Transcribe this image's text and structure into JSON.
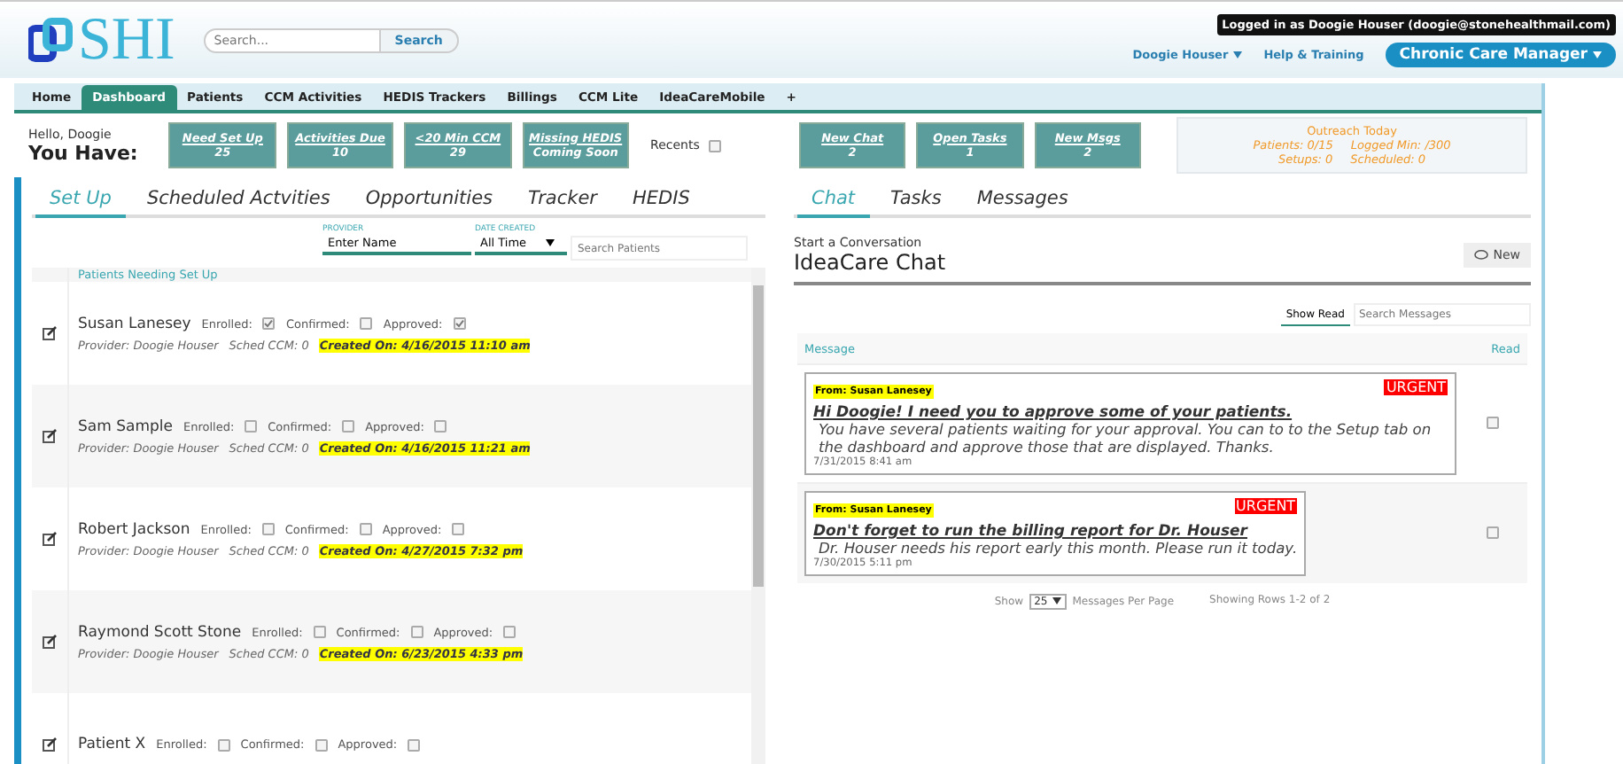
{
  "header": {
    "logo": "SHI",
    "search": {
      "placeholder": "Search...",
      "button": "Search"
    },
    "login_badge": "Logged in as Doogie Houser (doogie@stonehealthmail.com)",
    "user_menu": "Doogie Houser",
    "help_link": "Help & Training",
    "role_button": "Chronic Care Manager"
  },
  "nav": [
    {
      "label": "Home",
      "selected": false
    },
    {
      "label": "Dashboard",
      "selected": true
    },
    {
      "label": "Patients",
      "selected": false
    },
    {
      "label": "CCM Activities",
      "selected": false
    },
    {
      "label": "HEDIS Trackers",
      "selected": false
    },
    {
      "label": "Billings",
      "selected": false
    },
    {
      "label": "CCM Lite",
      "selected": false
    },
    {
      "label": "IdeaCareMobile",
      "selected": false
    },
    {
      "label": "+",
      "selected": false
    }
  ],
  "summary": {
    "greeting": "Hello, Doogie",
    "heading": "You Have:",
    "tiles": [
      {
        "label": "Need Set Up",
        "value": "25"
      },
      {
        "label": "Activities Due",
        "value": "10"
      },
      {
        "label": "<20 Min CCM",
        "value": "29"
      },
      {
        "label": "Missing HEDIS",
        "value": "Coming Soon"
      }
    ],
    "recents": {
      "label": "Recents",
      "checked": false
    },
    "chat_tiles": [
      {
        "label": "New Chat",
        "value": "2"
      },
      {
        "label": "Open Tasks",
        "value": "1"
      },
      {
        "label": "New Msgs",
        "value": "2"
      }
    ],
    "outreach": {
      "title": "Outreach Today",
      "lines": [
        [
          "Patients: 0/15",
          "Logged Min: /300"
        ],
        [
          "Setups: 0",
          "Scheduled: 0"
        ]
      ]
    }
  },
  "setup": {
    "tabs": [
      {
        "label": "Set Up",
        "selected": true
      },
      {
        "label": "Scheduled Actvities",
        "selected": false
      },
      {
        "label": "Opportunities",
        "selected": false
      },
      {
        "label": "Tracker",
        "selected": false
      },
      {
        "label": "HEDIS",
        "selected": false
      }
    ],
    "filters": {
      "provider": {
        "label": "PROVIDER",
        "value": "Enter Name"
      },
      "date_created": {
        "label": "DATE CREATED",
        "value": "All Time"
      },
      "search": {
        "placeholder": "Search Patients"
      }
    },
    "heading": "Patients Needing Set Up",
    "rows": [
      {
        "name": "Susan Lanesey",
        "flags": [
          {
            "label": "Enrolled:",
            "checked": true
          },
          {
            "label": "Confirmed:",
            "checked": false
          },
          {
            "label": "Approved:",
            "checked": true
          }
        ],
        "provider": "Provider: Doogie Houser",
        "sched": "Sched CCM: 0",
        "created": "Created On: 4/16/2015 11:10 am"
      },
      {
        "name": "Sam Sample",
        "flags": [
          {
            "label": "Enrolled:",
            "checked": false
          },
          {
            "label": "Confirmed:",
            "checked": false
          },
          {
            "label": "Approved:",
            "checked": false
          }
        ],
        "provider": "Provider: Doogie Houser",
        "sched": "Sched CCM: 0",
        "created": "Created On: 4/16/2015 11:21 am"
      },
      {
        "name": "Robert Jackson",
        "flags": [
          {
            "label": "Enrolled:",
            "checked": false
          },
          {
            "label": "Confirmed:",
            "checked": false
          },
          {
            "label": "Approved:",
            "checked": false
          }
        ],
        "provider": "Provider: Doogie Houser",
        "sched": "Sched CCM: 0",
        "created": "Created On: 4/27/2015 7:32 pm"
      },
      {
        "name": "Raymond Scott Stone",
        "flags": [
          {
            "label": "Enrolled:",
            "checked": false
          },
          {
            "label": "Confirmed:",
            "checked": false
          },
          {
            "label": "Approved:",
            "checked": false
          }
        ],
        "provider": "Provider: Doogie Houser",
        "sched": "Sched CCM: 0",
        "created": "Created On: 6/23/2015 4:33 pm"
      },
      {
        "name": "Patient X",
        "flags": [
          {
            "label": "Enrolled:",
            "checked": false
          },
          {
            "label": "Confirmed:",
            "checked": false
          },
          {
            "label": "Approved:",
            "checked": false
          }
        ]
      }
    ]
  },
  "chat": {
    "tabs": [
      {
        "label": "Chat",
        "selected": true
      },
      {
        "label": "Tasks",
        "selected": false
      },
      {
        "label": "Messages",
        "selected": false
      }
    ],
    "subtitle": "Start a Conversation",
    "title": "IdeaCare Chat",
    "new_button": "New",
    "show_read": "Show Read",
    "search": {
      "placeholder": "Search Messages"
    },
    "columns": [
      "Message",
      "Read"
    ],
    "messages": [
      {
        "from": "From: Susan Lanesey",
        "badge": "URGENT",
        "subject": "Hi Doogie! I need you to approve some of your patients.",
        "body": "You have several patients waiting for your approval. You can to to the Setup tab on the dashboard and approve those that are displayed. Thanks.",
        "date": "7/31/2015 8:41 am",
        "read": false
      },
      {
        "from": "From: Susan Lanesey",
        "badge": "URGENT",
        "subject": "Don't forget to run the billing report for Dr. Houser",
        "body": "Dr. Houser needs his report early this month. Please run it today.",
        "date": "7/30/2015 5:11 pm",
        "read": false
      }
    ],
    "footer": {
      "show": "Show",
      "per_page": "25",
      "per_page_label": "Messages Per Page",
      "rows": "Showing Rows 1-2 of 2"
    }
  }
}
